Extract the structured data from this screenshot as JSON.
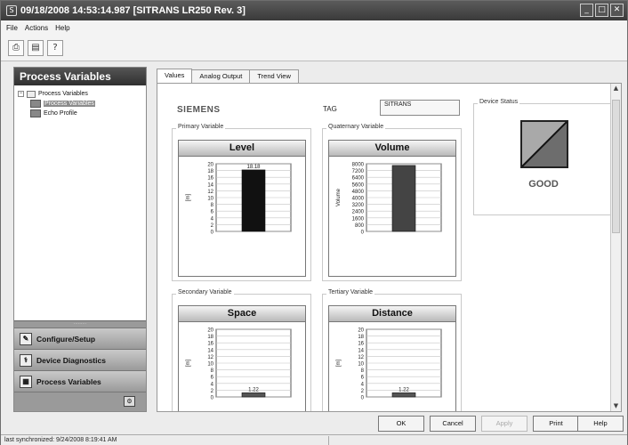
{
  "window": {
    "title": "09/18/2008 14:53:14.987 [SITRANS LR250 Rev. 3]",
    "app_icon": "siemens-app-icon",
    "controls": [
      "minimize-icon",
      "maximize-icon",
      "close-icon"
    ]
  },
  "menu": {
    "items": [
      "File",
      "Actions",
      "Help"
    ]
  },
  "toolbar": {
    "icons": [
      "print-icon",
      "print-preview-icon",
      "context-help-icon"
    ]
  },
  "sidebar": {
    "title": "Process Variables",
    "tree": [
      {
        "label": "Process Variables",
        "level": 0,
        "expander": "−",
        "icon": "folder-icon",
        "selected": false
      },
      {
        "label": "Process Variables",
        "level": 1,
        "icon": "process-variables-icon",
        "selected": true
      },
      {
        "label": "Echo Profile",
        "level": 1,
        "icon": "echo-profile-icon",
        "selected": false
      }
    ],
    "nav_buttons": [
      {
        "label": "Configure/Setup",
        "icon": "configure-icon"
      },
      {
        "label": "Device Diagnostics",
        "icon": "diagnostics-icon"
      },
      {
        "label": "Process Variables",
        "icon": "process-variables-icon"
      }
    ],
    "footer_icon": "options-icon"
  },
  "tabs": [
    {
      "label": "Values",
      "active": true
    },
    {
      "label": "Analog Output",
      "active": false
    },
    {
      "label": "Trend View",
      "active": false
    }
  ],
  "main": {
    "brand": "SIEMENS",
    "tag_label": "TAG",
    "tag_value": "SITRANS",
    "device_status_label": "Device Status",
    "device_status_value": "GOOD"
  },
  "chart_data": [
    {
      "type": "bar",
      "group_label": "Primary Variable",
      "title": "Level",
      "ylabel": "[m]",
      "ylim": [
        0,
        20
      ],
      "yticks": [
        0,
        2,
        4,
        6,
        8,
        10,
        12,
        14,
        16,
        18,
        20
      ],
      "values": [
        18.18
      ],
      "data_label": "18.18",
      "color": "#111111"
    },
    {
      "type": "bar",
      "group_label": "Quaternary Variable",
      "title": "Volume",
      "ylabel": "Volume",
      "ylim": [
        0,
        8000
      ],
      "yticks": [
        0,
        800,
        1600,
        2400,
        3200,
        4000,
        4800,
        5600,
        6400,
        7200,
        8000
      ],
      "values": [
        7800
      ],
      "color": "#444444"
    },
    {
      "type": "bar",
      "group_label": "Secondary Variable",
      "title": "Space",
      "ylabel": "[m]",
      "ylim": [
        0,
        20
      ],
      "yticks": [
        0,
        2,
        4,
        6,
        8,
        10,
        12,
        14,
        16,
        18,
        20
      ],
      "values": [
        1.22
      ],
      "data_label": "1.22",
      "color": "#555555"
    },
    {
      "type": "bar",
      "group_label": "Tertiary Variable",
      "title": "Distance",
      "ylabel": "[m]",
      "ylim": [
        0,
        20
      ],
      "yticks": [
        0,
        2,
        4,
        6,
        8,
        10,
        12,
        14,
        16,
        18,
        20
      ],
      "values": [
        1.22
      ],
      "data_label": "1.22",
      "color": "#555555"
    }
  ],
  "buttons": {
    "ok": "OK",
    "cancel": "Cancel",
    "apply": "Apply",
    "print": "Print",
    "help": "Help"
  },
  "statusbar": {
    "text": "last synchronized: 9/24/2008 8:19:41 AM"
  }
}
